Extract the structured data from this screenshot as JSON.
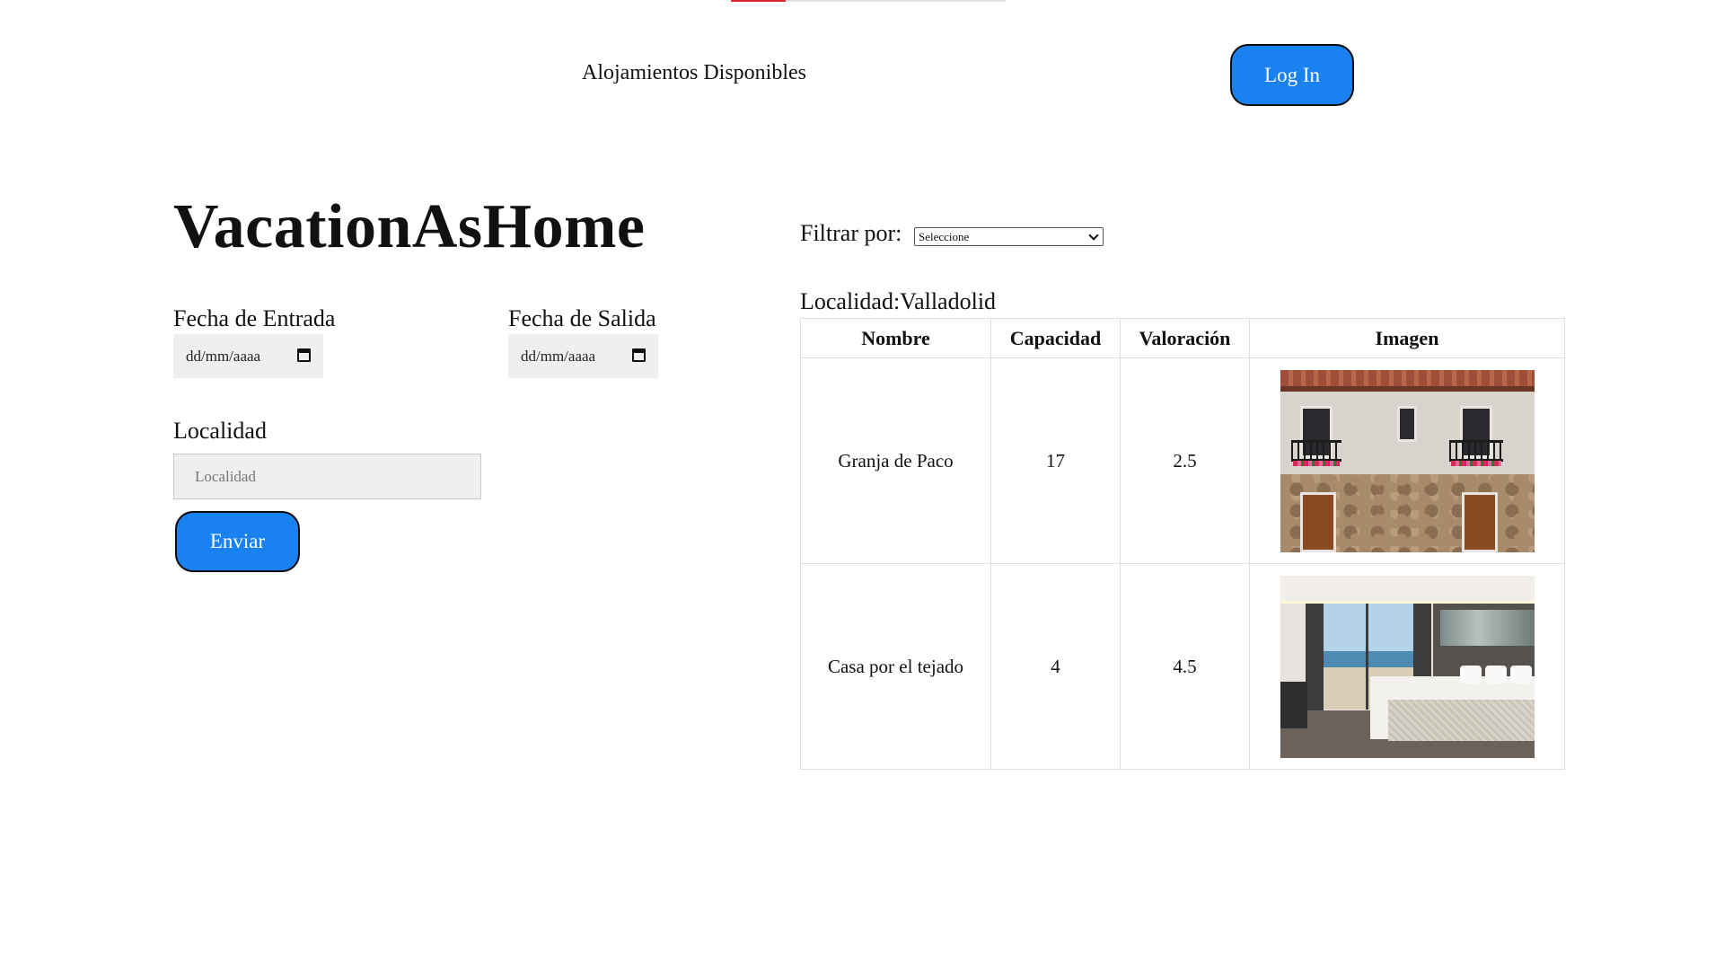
{
  "top_strip": {
    "progress": 0.2
  },
  "header": {
    "nav_link": "Alojamientos Disponibles",
    "login_label": "Log In"
  },
  "brand": "VacationAsHome",
  "form": {
    "entrada_label": "Fecha de Entrada",
    "entrada_value": "dd/mm/aaaa",
    "salida_label": "Fecha de Salida",
    "salida_value": "dd/mm/aaaa",
    "localidad_label": "Localidad",
    "localidad_placeholder": "Localidad",
    "submit_label": "Enviar"
  },
  "filter": {
    "label": "Filtrar por:",
    "selected": "Seleccione"
  },
  "results": {
    "heading": "Localidad:Valladolid",
    "columns": [
      "Nombre",
      "Capacidad",
      "Valoración",
      "Imagen"
    ],
    "rows": [
      {
        "nombre": "Granja de Paco",
        "capacidad": "17",
        "valoracion": "2.5",
        "imagen": "stone-house-photo"
      },
      {
        "nombre": "Casa por el tejado",
        "capacidad": "4",
        "valoracion": "4.5",
        "imagen": "bedroom-photo"
      }
    ]
  },
  "colors": {
    "accent_blue": "#1a82f0",
    "strip_red": "#d9262f"
  }
}
